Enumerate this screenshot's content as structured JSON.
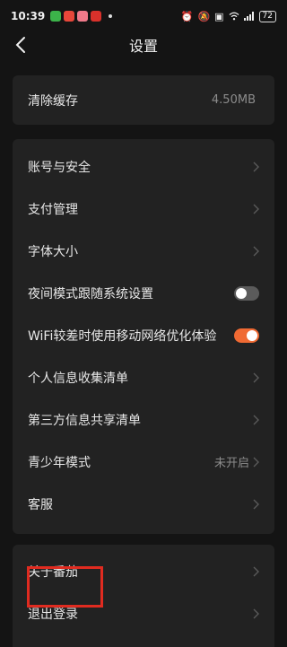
{
  "status_bar": {
    "time": "10:39",
    "battery": "72",
    "icons": [
      "app-green-icon",
      "app-red-icon",
      "app-pink-icon",
      "app-red2-icon",
      "alarm-icon",
      "mute-icon",
      "nfc-icon",
      "wifi-icon",
      "signal-icon"
    ]
  },
  "header": {
    "title": "设置"
  },
  "cache": {
    "label": "清除缓存",
    "value": "4.50MB"
  },
  "settings": {
    "account": "账号与安全",
    "payment": "支付管理",
    "font_size": "字体大小",
    "night_mode": "夜间模式跟随系统设置",
    "night_mode_on": false,
    "wifi_opt": "WiFi较差时使用移动网络优化体验",
    "wifi_opt_on": true,
    "personal_info": "个人信息收集清单",
    "third_party": "第三方信息共享清单",
    "teen_mode": "青少年模式",
    "teen_mode_value": "未开启",
    "customer_service": "客服"
  },
  "bottom": {
    "about": "关于番茄",
    "logout": "退出登录"
  },
  "colors": {
    "background": "#141414",
    "card": "#222222",
    "accent": "#f06a33",
    "highlight": "#e02b20"
  }
}
